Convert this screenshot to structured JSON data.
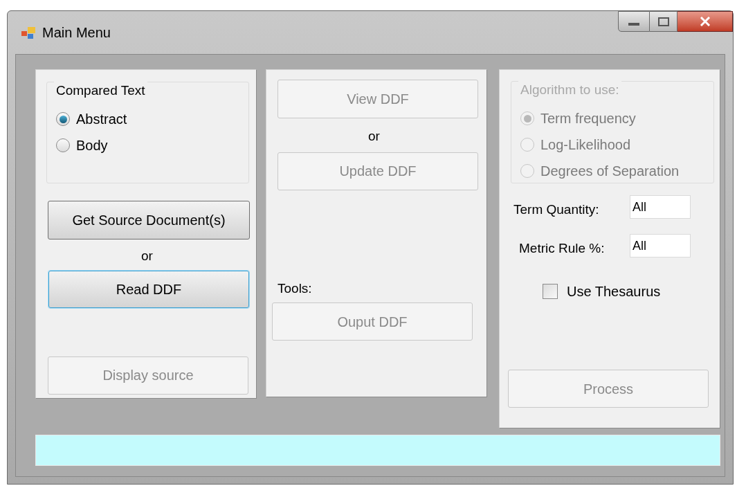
{
  "window": {
    "title": "Main Menu"
  },
  "left_panel": {
    "group_title": "Compared Text",
    "radios": [
      {
        "label": "Abstract",
        "selected": true
      },
      {
        "label": "Body",
        "selected": false
      }
    ],
    "get_button": {
      "label": "Get Source Document(s)",
      "disabled": false,
      "focused": false
    },
    "or_text": "or",
    "read_button": {
      "label": "Read DDF",
      "disabled": false,
      "focused": true
    },
    "display_button": {
      "label": "Display source",
      "disabled": true,
      "focused": false
    }
  },
  "middle_panel": {
    "view_button": {
      "label": "View DDF",
      "disabled": true,
      "focused": false
    },
    "or_text": "or",
    "update_button": {
      "label": "Update DDF",
      "disabled": true,
      "focused": false
    },
    "tools_label": "Tools:",
    "output_button": {
      "label": "Ouput DDF",
      "disabled": true,
      "focused": false
    }
  },
  "right_panel": {
    "group_title": "Algorithm to use:",
    "disabled": true,
    "radios": [
      {
        "label": "Term frequency",
        "selected": true
      },
      {
        "label": "Log-Likelihood",
        "selected": false
      },
      {
        "label": "Degrees of Separation",
        "selected": false
      }
    ],
    "fields": [
      {
        "label": "Term Quantity:",
        "value": "All"
      },
      {
        "label": "Metric Rule %:",
        "value": "All"
      }
    ],
    "checkbox": {
      "label": "Use Thesaurus",
      "checked": false
    },
    "process_button": {
      "label": "Process",
      "disabled": true,
      "focused": false
    }
  }
}
